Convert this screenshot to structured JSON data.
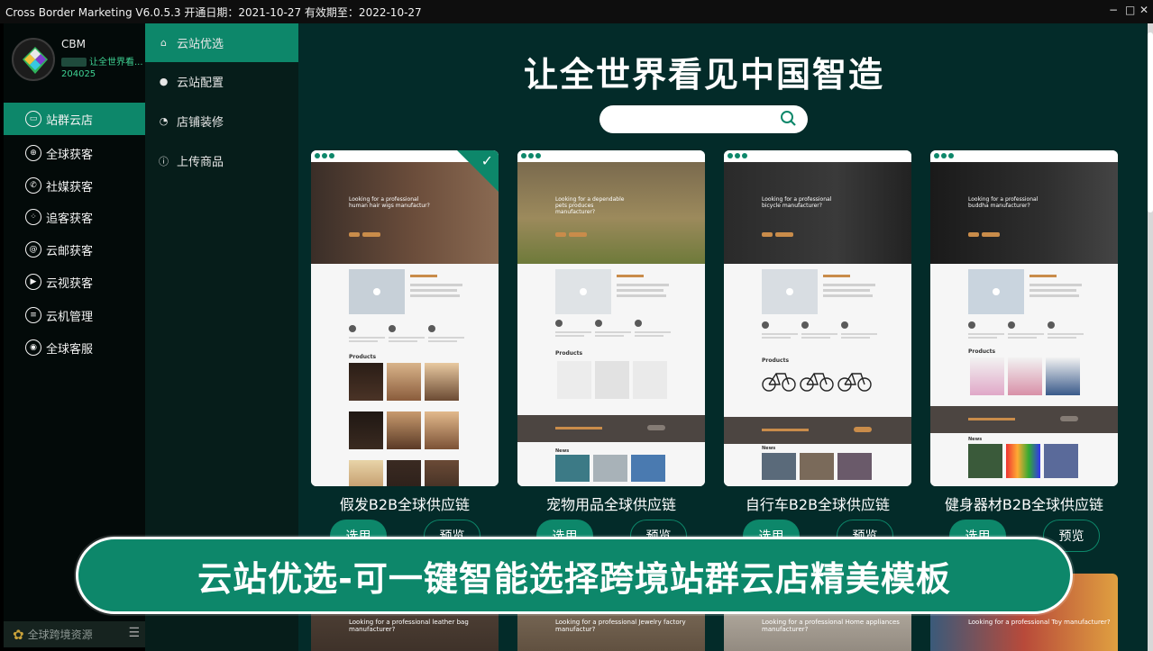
{
  "window": {
    "title": "Cross Border Marketing V6.0.5.3 开通日期：2021-10-27 有效期至：2022-10-27",
    "minimize": "−",
    "maximize": "□",
    "close": "✕"
  },
  "profile": {
    "name": "CBM",
    "slogan": "让全世界看...",
    "uid": "204025"
  },
  "sidebar": {
    "items": [
      {
        "label": "站群云店",
        "icon": "monitor-icon",
        "glyph": "▭"
      },
      {
        "label": "全球获客",
        "icon": "globe-icon",
        "glyph": "⊕"
      },
      {
        "label": "社媒获客",
        "icon": "whatsapp-icon",
        "glyph": "✆"
      },
      {
        "label": "追客获客",
        "icon": "grid-icon",
        "glyph": "⁘"
      },
      {
        "label": "云邮获客",
        "icon": "email-icon",
        "glyph": "@"
      },
      {
        "label": "云视获客",
        "icon": "play-icon",
        "glyph": "▶"
      },
      {
        "label": "云机管理",
        "icon": "server-icon",
        "glyph": "≡"
      },
      {
        "label": "全球客服",
        "icon": "headset-icon",
        "glyph": "◉"
      }
    ],
    "footer": "全球跨境资源"
  },
  "subnav": {
    "items": [
      {
        "label": "云站优选",
        "icon": "home-icon",
        "glyph": "⌂"
      },
      {
        "label": "云站配置",
        "icon": "globe-icon",
        "glyph": "●"
      },
      {
        "label": "店铺装修",
        "icon": "palette-icon",
        "glyph": "◔"
      },
      {
        "label": "上传商品",
        "icon": "upload-icon",
        "glyph": "ⓘ"
      }
    ]
  },
  "main": {
    "headline": "让全世界看见中国智造",
    "search_placeholder": "",
    "select_label": "选用",
    "preview_label": "预览",
    "templates": [
      {
        "name": "假发B2B全球供应链",
        "hero": "Looking for a professional human hair wigs manufactur?",
        "selected": true
      },
      {
        "name": "宠物用品全球供应链",
        "hero": "Looking for a dependable pets produces manufacturer?",
        "selected": false
      },
      {
        "name": "自行车B2B全球供应链",
        "hero": "Looking for a professional bicycle manufacturer?",
        "selected": false
      },
      {
        "name": "健身器材B2B全球供应链",
        "hero": "Looking for a professional buddha manufacturer?",
        "selected": false
      }
    ],
    "templates_row2": [
      {
        "hero": "Looking for a professional leather bag manufacturer?"
      },
      {
        "hero": "Looking for a professional Jewelry factory manufactur?"
      },
      {
        "hero": "Looking for a professional Home appliances manufacturer?"
      },
      {
        "hero": "Looking for a professional Toy manufacturer?"
      }
    ],
    "banner": "云站优选-可一键智能选择跨境站群云店精美模板"
  },
  "colors": {
    "accent": "#0d876a",
    "main_bg": "#032b29",
    "sidebar_bg": "#030a09"
  }
}
